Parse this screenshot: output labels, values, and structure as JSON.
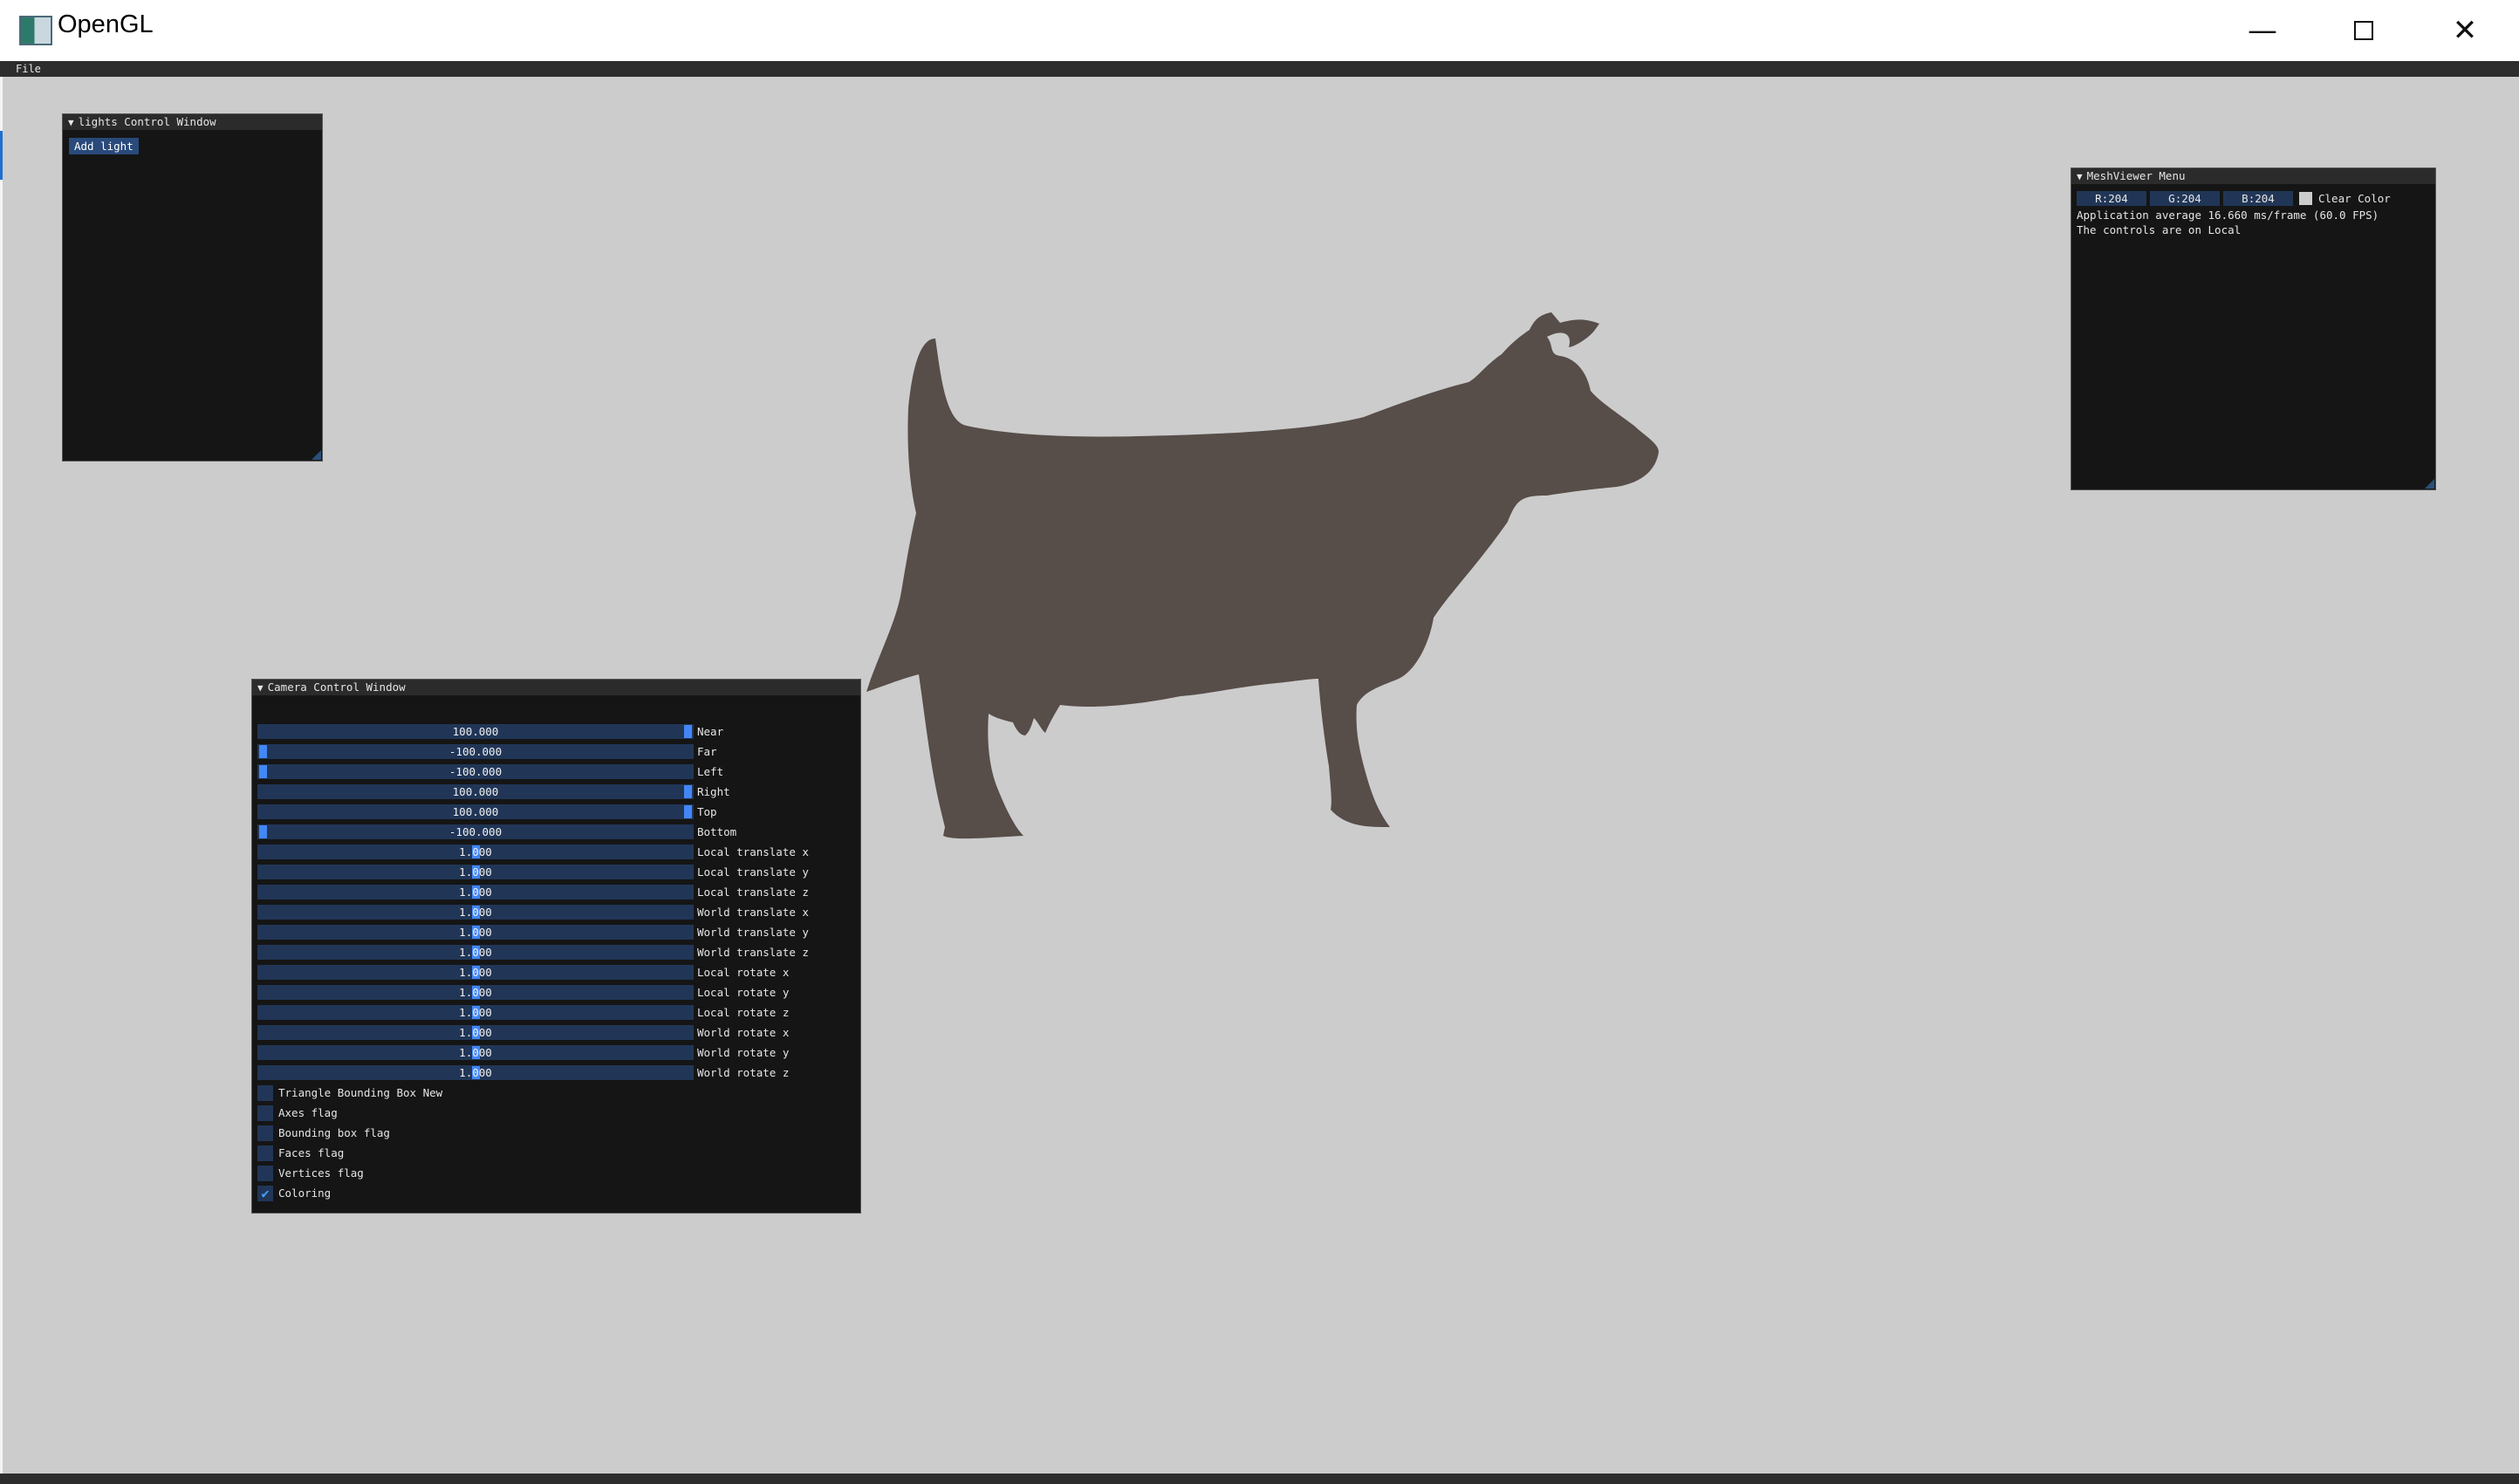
{
  "window": {
    "title": "OpenGL",
    "minimize_icon": "minimize-icon",
    "maximize_icon": "maximize-icon",
    "close_icon": "close-icon"
  },
  "menubar": {
    "file": "File"
  },
  "lights_window": {
    "title": "lights Control Window",
    "add_light": "Add light"
  },
  "meshviewer": {
    "title": "MeshViewer Menu",
    "r": "R:204",
    "g": "G:204",
    "b": "B:204",
    "clear_color_label": "Clear Color",
    "swatch_color": "#cccccc",
    "fps_text": "Application average 16.660 ms/frame (60.0 FPS)",
    "controls_text": "The controls are on Local"
  },
  "camera": {
    "title": "Camera Control Window",
    "sliders": [
      {
        "label": "Near",
        "value": "100.000",
        "position": 1.0
      },
      {
        "label": "Far",
        "value": "-100.000",
        "position": 0.0
      },
      {
        "label": "Left",
        "value": "-100.000",
        "position": 0.0
      },
      {
        "label": "Right",
        "value": "100.000",
        "position": 1.0
      },
      {
        "label": "Top",
        "value": "100.000",
        "position": 1.0
      },
      {
        "label": "Bottom",
        "value": "-100.000",
        "position": 0.0
      },
      {
        "label": "Local translate x",
        "value": "1.000",
        "position": 0.5
      },
      {
        "label": "Local translate y",
        "value": "1.000",
        "position": 0.5
      },
      {
        "label": "Local translate z",
        "value": "1.000",
        "position": 0.5
      },
      {
        "label": "World translate x",
        "value": "1.000",
        "position": 0.5
      },
      {
        "label": "World translate y",
        "value": "1.000",
        "position": 0.5
      },
      {
        "label": "World translate z",
        "value": "1.000",
        "position": 0.5
      },
      {
        "label": "Local rotate x",
        "value": "1.000",
        "position": 0.5
      },
      {
        "label": "Local rotate y",
        "value": "1.000",
        "position": 0.5
      },
      {
        "label": "Local rotate z",
        "value": "1.000",
        "position": 0.5
      },
      {
        "label": "World rotate x",
        "value": "1.000",
        "position": 0.5
      },
      {
        "label": "World rotate y",
        "value": "1.000",
        "position": 0.5
      },
      {
        "label": "World rotate z",
        "value": "1.000",
        "position": 0.5
      }
    ],
    "checkboxes": [
      {
        "label": "Triangle Bounding Box New",
        "checked": false
      },
      {
        "label": "Axes flag",
        "checked": false
      },
      {
        "label": "Bounding box flag",
        "checked": false
      },
      {
        "label": "Faces flag",
        "checked": false
      },
      {
        "label": "Vertices flag",
        "checked": false
      },
      {
        "label": "Coloring",
        "checked": true
      }
    ]
  },
  "model": {
    "color": "#574d49"
  }
}
